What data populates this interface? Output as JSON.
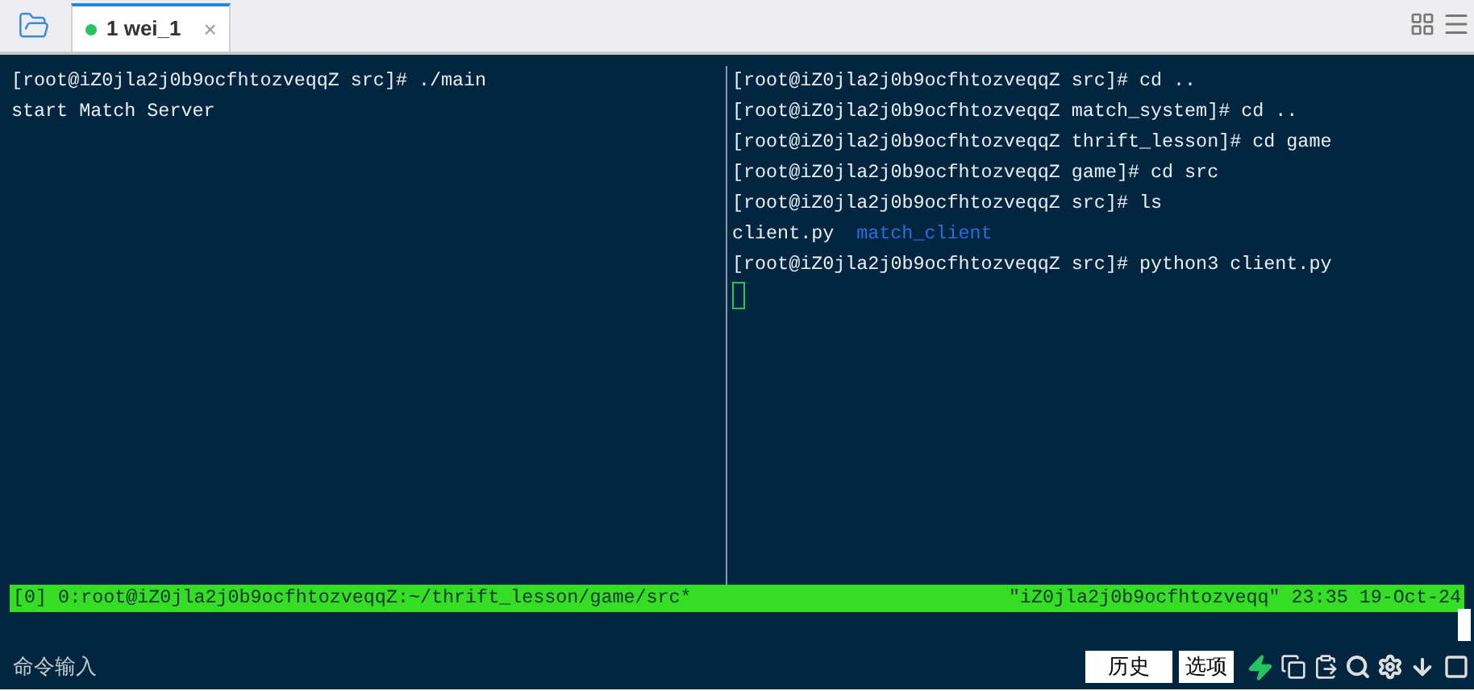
{
  "tabs": [
    {
      "label": "1 wei_1",
      "selected": true,
      "connected": true,
      "close": "×"
    }
  ],
  "left_pane": {
    "lines": [
      {
        "segments": [
          {
            "kind": "text",
            "text": "[root@iZ0jla2j0b9ocfhtozveqqZ src]# ./main"
          }
        ]
      },
      {
        "segments": [
          {
            "kind": "text",
            "text": "start Match Server"
          }
        ]
      }
    ]
  },
  "right_pane": {
    "lines": [
      {
        "segments": [
          {
            "kind": "text",
            "text": "[root@iZ0jla2j0b9ocfhtozveqqZ src]# cd .."
          }
        ]
      },
      {
        "segments": [
          {
            "kind": "text",
            "text": "[root@iZ0jla2j0b9ocfhtozveqqZ match_system]# cd .."
          }
        ]
      },
      {
        "segments": [
          {
            "kind": "text",
            "text": "[root@iZ0jla2j0b9ocfhtozveqqZ thrift_lesson]# cd game"
          }
        ]
      },
      {
        "segments": [
          {
            "kind": "text",
            "text": "[root@iZ0jla2j0b9ocfhtozveqqZ game]# cd src"
          }
        ]
      },
      {
        "segments": [
          {
            "kind": "text",
            "text": "[root@iZ0jla2j0b9ocfhtozveqqZ src]# ls"
          }
        ]
      },
      {
        "segments": [
          {
            "kind": "text",
            "text": "client.py"
          },
          {
            "kind": "directory",
            "text": "match_client"
          }
        ]
      },
      {
        "segments": [
          {
            "kind": "text",
            "text": "[root@iZ0jla2j0b9ocfhtozveqqZ src]# python3 client.py"
          }
        ]
      },
      {
        "segments": [
          {
            "kind": "cursor"
          }
        ]
      }
    ]
  },
  "status_bar": {
    "left": "[0] 0:root@iZ0jla2j0b9ocfhtozveqqZ:~/thrift_lesson/game/src*",
    "right": "\"iZ0jla2j0b9ocfhtozveqq\" 23:35 19-Oct-24"
  },
  "command_input": {
    "placeholder": "命令输入"
  },
  "buttons": [
    "历史",
    "选项"
  ]
}
